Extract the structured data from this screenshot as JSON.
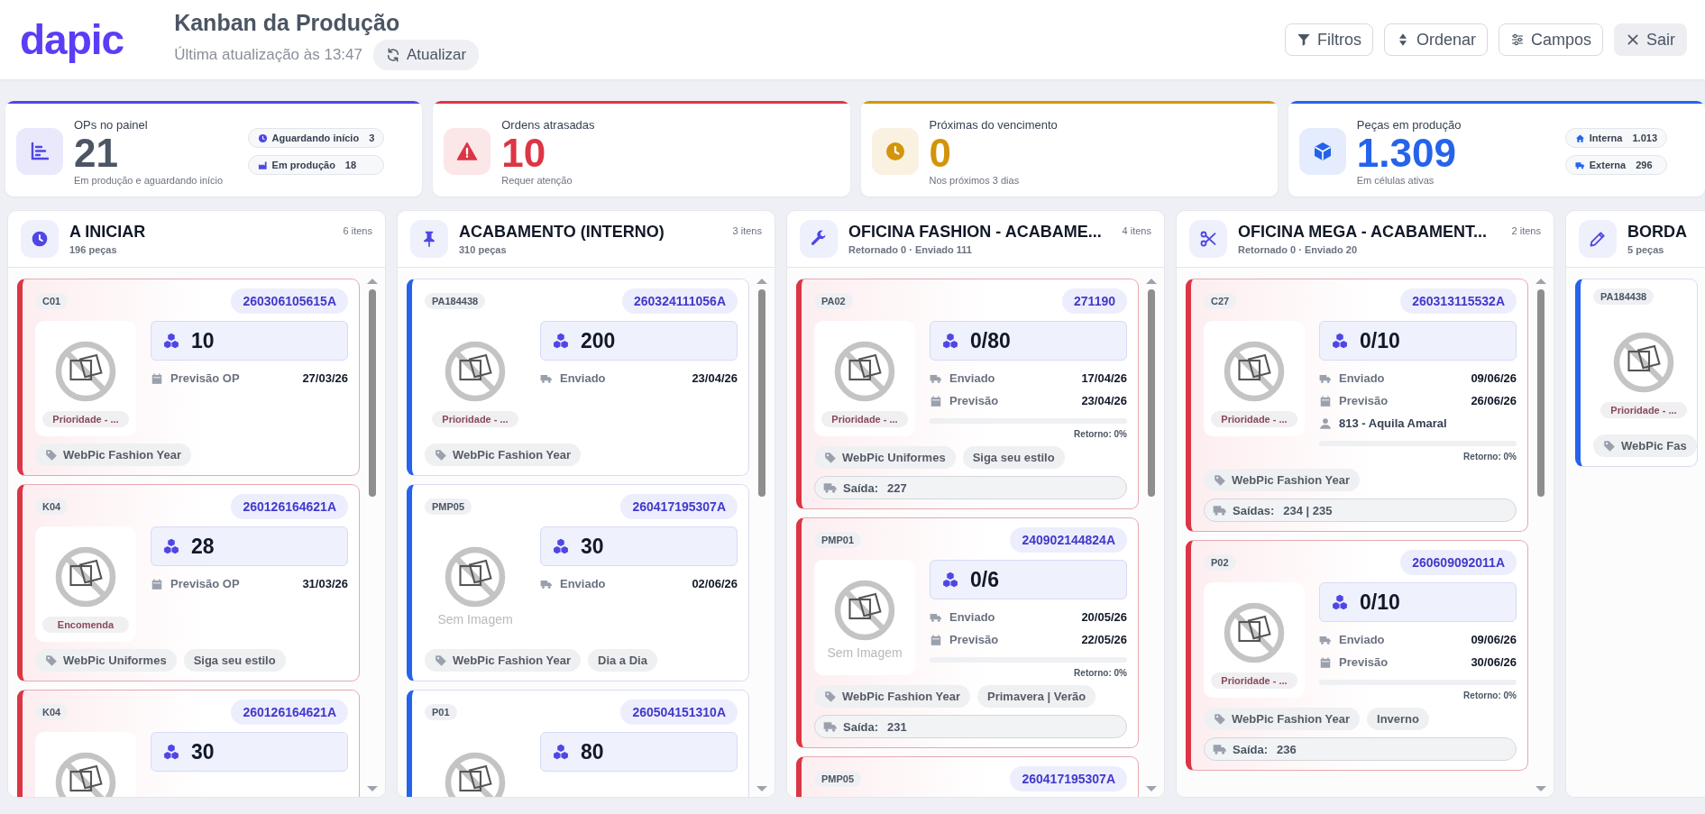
{
  "header": {
    "logo": "dapic",
    "title": "Kanban da Produção",
    "updated": "Última atualização às 13:47",
    "refresh": {
      "label": "Atualizar",
      "kind": "refresh"
    },
    "actions": [
      {
        "label": "Filtros",
        "kind": "filter"
      },
      {
        "label": "Ordenar",
        "kind": "sort"
      },
      {
        "label": "Campos",
        "kind": "sliders"
      },
      {
        "label": "Sair",
        "kind": "close"
      }
    ]
  },
  "stats": [
    {
      "label": "OPs no painel",
      "value": "21",
      "subtitle": "Em produção e aguardando início",
      "kind": "chart",
      "color": "#4f46e5",
      "highlight": false,
      "pills": [
        {
          "kind": "clock",
          "label": "Aguardando início",
          "value": "3"
        },
        {
          "kind": "factory",
          "label": "Em produção",
          "value": "18"
        }
      ]
    },
    {
      "label": "Ordens atrasadas",
      "value": "10",
      "subtitle": "Requer atenção",
      "kind": "warning",
      "color": "#dc3545",
      "highlight": true
    },
    {
      "label": "Próximas do vencimento",
      "value": "0",
      "subtitle": "Nos próximos 3 dias",
      "kind": "clock",
      "color": "#d4940a",
      "highlight": true
    },
    {
      "label": "Peças em produção",
      "value": "1.309",
      "subtitle": "Em células ativas",
      "kind": "cube",
      "color": "#2563eb",
      "highlight": true,
      "pills": [
        {
          "kind": "home",
          "label": "Interna",
          "value": "1.013"
        },
        {
          "kind": "truck",
          "label": "Externa",
          "value": "296"
        }
      ]
    }
  ],
  "columns": [
    {
      "title": "A INICIAR",
      "subtitle": "196 peças",
      "count": "6 itens",
      "kind": "clock",
      "cards": [
        {
          "code": "C01",
          "op": "260306105615A",
          "late": true,
          "chip": "Prioridade - ...",
          "qty": "10",
          "rows": [
            {
              "kind": "calendar",
              "label": "Previsão OP",
              "value": "27/03/26"
            }
          ],
          "tags": [
            {
              "label": "WebPic Fashion Year",
              "kind": "category"
            }
          ]
        },
        {
          "code": "K04",
          "op": "260126164621A",
          "late": true,
          "chip": "Encomenda",
          "qty": "28",
          "rows": [
            {
              "kind": "calendar",
              "label": "Previsão OP",
              "value": "31/03/26"
            }
          ],
          "tags": [
            {
              "label": "WebPic Uniformes",
              "kind": "category"
            },
            {
              "label": "Siga seu estilo",
              "kind": "plain"
            }
          ]
        },
        {
          "code": "K04",
          "op": "260126164621A",
          "late": true,
          "qty": "30"
        }
      ]
    },
    {
      "title": "ACABAMENTO (INTERNO)",
      "subtitle": "310 peças",
      "count": "3 itens",
      "kind": "pin",
      "cards": [
        {
          "code": "PA184438",
          "op": "260324111056A",
          "late": false,
          "chip": "Prioridade - ...",
          "qty": "200",
          "rows": [
            {
              "kind": "truck",
              "label": "Enviado",
              "value": "23/04/26"
            }
          ],
          "tags": [
            {
              "label": "WebPic Fashion Year",
              "kind": "category"
            }
          ]
        },
        {
          "code": "PMP05",
          "op": "260417195307A",
          "late": false,
          "caption": "Sem Imagem",
          "qty": "30",
          "rows": [
            {
              "kind": "truck",
              "label": "Enviado",
              "value": "02/06/26"
            }
          ],
          "tags": [
            {
              "label": "WebPic Fashion Year",
              "kind": "category"
            },
            {
              "label": "Dia a Dia",
              "kind": "plain"
            }
          ]
        },
        {
          "code": "P01",
          "op": "260504151310A",
          "late": false,
          "qty": "80"
        }
      ]
    },
    {
      "title": "OFICINA FASHION - ACABAME...",
      "subtitle": "Retornado 0 · Enviado 111",
      "count": "4 itens",
      "kind": "wrench",
      "cards": [
        {
          "code": "PA02",
          "op": "271190",
          "late": true,
          "chip": "Prioridade - ...",
          "qty": "0/80",
          "rows": [
            {
              "kind": "truck",
              "label": "Enviado",
              "value": "17/04/26"
            },
            {
              "kind": "calendar",
              "label": "Previsão",
              "value": "23/04/26"
            }
          ],
          "progress": {
            "level": 0,
            "label": "Retorno: 0%"
          },
          "tags": [
            {
              "label": "WebPic Uniformes",
              "kind": "category"
            },
            {
              "label": "Siga seu estilo",
              "kind": "plain"
            }
          ],
          "exit": {
            "label": "Saída:",
            "value": "227"
          }
        },
        {
          "code": "PMP01",
          "op": "240902144824A",
          "late": true,
          "caption": "Sem Imagem",
          "qty": "0/6",
          "rows": [
            {
              "kind": "truck",
              "label": "Enviado",
              "value": "20/05/26"
            },
            {
              "kind": "calendar",
              "label": "Previsão",
              "value": "22/05/26"
            }
          ],
          "progress": {
            "level": 0,
            "label": "Retorno: 0%"
          },
          "tags": [
            {
              "label": "WebPic Fashion Year",
              "kind": "category"
            },
            {
              "label": "Primavera | Verão",
              "kind": "plain"
            }
          ],
          "exit": {
            "label": "Saída:",
            "value": "231"
          }
        },
        {
          "code": "PMP05",
          "op": "260417195307A",
          "late": true
        }
      ]
    },
    {
      "title": "OFICINA MEGA - ACABAMENT...",
      "subtitle": "Retornado 0 · Enviado 20",
      "count": "2 itens",
      "kind": "scissors",
      "cards": [
        {
          "code": "C27",
          "op": "260313115532A",
          "late": true,
          "chip": "Prioridade - ...",
          "qty": "0/10",
          "rows": [
            {
              "kind": "truck",
              "label": "Enviado",
              "value": "09/06/26"
            },
            {
              "kind": "calendar",
              "label": "Previsão",
              "value": "26/06/26"
            },
            {
              "kind": "person",
              "label": "813 - Aquila Amaral"
            }
          ],
          "progress": {
            "level": 0,
            "label": "Retorno: 0%"
          },
          "tags": [
            {
              "label": "WebPic Fashion Year",
              "kind": "category"
            }
          ],
          "exit": {
            "label": "Saídas:",
            "value": "234 | 235"
          }
        },
        {
          "code": "P02",
          "op": "260609092011A",
          "late": true,
          "chip": "Prioridade - ...",
          "qty": "0/10",
          "rows": [
            {
              "kind": "truck",
              "label": "Enviado",
              "value": "09/06/26"
            },
            {
              "kind": "calendar",
              "label": "Previsão",
              "value": "30/06/26"
            }
          ],
          "progress": {
            "level": 0,
            "label": "Retorno: 0%"
          },
          "tags": [
            {
              "label": "WebPic Fashion Year",
              "kind": "category"
            },
            {
              "label": "Inverno",
              "kind": "plain"
            }
          ],
          "exit": {
            "label": "Saída:",
            "value": "236"
          }
        }
      ]
    },
    {
      "title": "BORDA",
      "subtitle": "5 peças",
      "kind": "pencil",
      "cards": [
        {
          "code": "PA184438",
          "late": false,
          "chip": "Prioridade - ...",
          "tags": [
            {
              "label": "WebPic Fas",
              "kind": "category"
            }
          ]
        }
      ]
    }
  ]
}
